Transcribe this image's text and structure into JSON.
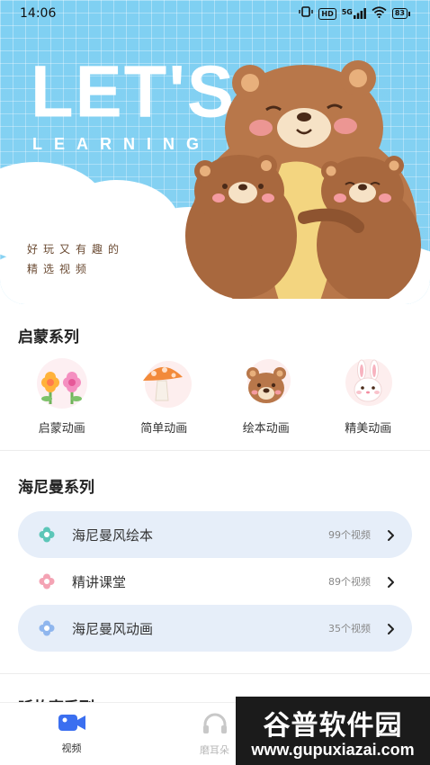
{
  "status_bar": {
    "time": "14:06",
    "icons": [
      "vibrate-icon",
      "hd-icon",
      "signal-5g-icon",
      "wifi-icon",
      "battery-icon"
    ],
    "hd_text": "HD",
    "network_text": "5G",
    "battery_text": "83"
  },
  "hero": {
    "title": "LET'S",
    "subtitle": "LEARNING",
    "tagline_line1": "好玩又有趣的",
    "tagline_line2": "精选视频",
    "colors": {
      "sky": "#7fd0f2",
      "bear": "#b8774a",
      "belly": "#f3d580"
    }
  },
  "qimeng": {
    "title": "启蒙系列",
    "items": [
      {
        "label": "启蒙动画",
        "icon": "flowers-icon"
      },
      {
        "label": "简单动画",
        "icon": "mushroom-icon"
      },
      {
        "label": "绘本动画",
        "icon": "bear-face-icon"
      },
      {
        "label": "精美动画",
        "icon": "bunny-icon"
      }
    ]
  },
  "haini": {
    "title": "海尼曼系列",
    "rows": [
      {
        "label": "海尼曼风绘本",
        "count": "99个视频",
        "icon": "flower-teal-icon",
        "highlight": true
      },
      {
        "label": "精讲课堂",
        "count": "89个视频",
        "icon": "flower-pink-icon",
        "highlight": false
      },
      {
        "label": "海尼曼风动画",
        "count": "35个视频",
        "icon": "flower-blue-icon",
        "highlight": true
      }
    ]
  },
  "next_section_title": "听故事系列",
  "bottom_nav": {
    "items": [
      {
        "label": "视频",
        "icon": "video-camera-icon",
        "active": true
      },
      {
        "label": "磨耳朵",
        "icon": "headphones-icon",
        "active": false
      }
    ]
  },
  "watermark": {
    "brand": "谷普软件园",
    "url": "www.gupuxiazai.com"
  }
}
